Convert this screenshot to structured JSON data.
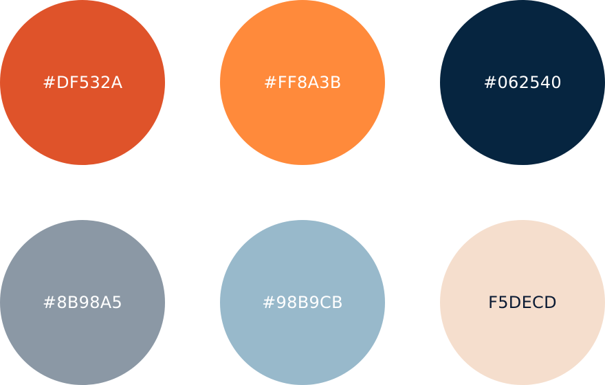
{
  "swatches": [
    {
      "label": "#DF532A",
      "color": "#DF532A",
      "text_color": "#FFFFFF"
    },
    {
      "label": "#FF8A3B",
      "color": "#FF8A3B",
      "text_color": "#FFFFFF"
    },
    {
      "label": "#062540",
      "color": "#062540",
      "text_color": "#FFFFFF"
    },
    {
      "label": "#8B98A5",
      "color": "#8B98A5",
      "text_color": "#FFFFFF"
    },
    {
      "label": "#98B9CB",
      "color": "#98B9CB",
      "text_color": "#FFFFFF"
    },
    {
      "label": "F5DECD",
      "color": "#F5DECD",
      "text_color": "#0A1A33"
    }
  ]
}
